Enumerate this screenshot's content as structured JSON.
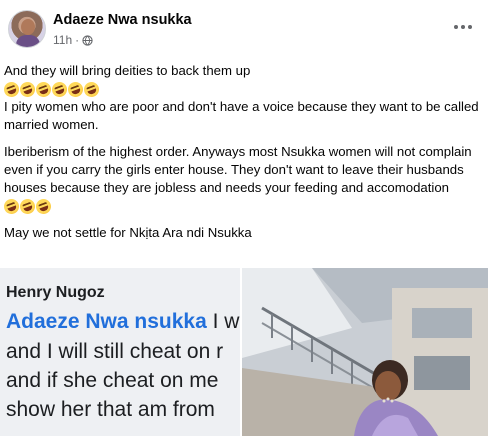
{
  "post": {
    "author": "Adaeze Nwa nsukka",
    "time": "11h",
    "separator": "·",
    "audience_icon": "globe-icon",
    "more_icon": "more-options-icon"
  },
  "body": {
    "line1": "And they will bring deities to back them up",
    "emoji_name": "rolling-on-floor-laughing-emoji",
    "line2": "I pity women who are poor and don't have a voice because they want to be called married women.",
    "line3": "Iberiberism of the highest order. Anyways most Nsukka women will not complain even if you carry the girls enter house. They don't want to leave their husbands houses because they are jobless and needs your feeding and accomodation",
    "line4": "May we not settle for Nkịta Ara ndi Nsukka"
  },
  "screenshot": {
    "name": "Henry Nugoz",
    "tag": "Adaeze Nwa nsukka",
    "tag_tail": " I w",
    "line2": "and I will still cheat on r",
    "line3": "and if she cheat on me",
    "line4": "show her that am from"
  },
  "colors": {
    "text": "#050505",
    "meta": "#65676b",
    "link": "#216fdb",
    "screenshot_bg": "#eef0f3"
  }
}
